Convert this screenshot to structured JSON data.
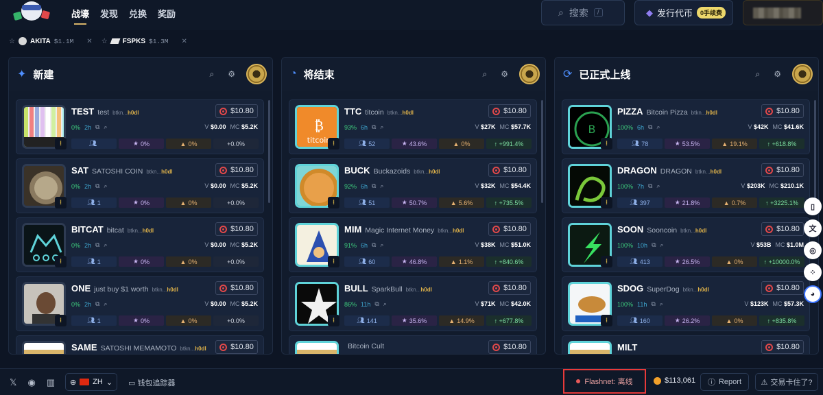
{
  "nav": {
    "items": [
      "战壕",
      "发现",
      "兑换",
      "奖励"
    ],
    "active": 0
  },
  "header": {
    "search_label": "搜索",
    "search_shortcut": "/",
    "issue_label": "发行代币",
    "issue_fee_badge": "0手续费"
  },
  "watchlist": [
    {
      "symbol": "AKITA",
      "value": "$1.1M"
    },
    {
      "symbol": "FSPKS",
      "value": "$1.3M"
    }
  ],
  "panels": [
    {
      "title": "新建",
      "cards": [
        {
          "symbol": "TEST",
          "name": "test",
          "creator_prefix": "btkn...",
          "creator_suffix": "h0dl",
          "price": "$10.80",
          "pct": "0%",
          "age": "2h",
          "vol": "$0.00",
          "mc": "$5.2K",
          "holders": "",
          "stars": "0%",
          "fire": "0%",
          "change": "0.0%",
          "change_label": "+0.0%",
          "thumb": "grid",
          "cyan": false
        },
        {
          "symbol": "SAT",
          "name": "SATOSHI COIN",
          "creator_prefix": "btkn...",
          "creator_suffix": "h0dl",
          "price": "$10.80",
          "pct": "0%",
          "age": "2h",
          "vol": "$0.00",
          "mc": "$5.2K",
          "holders": "1",
          "stars": "0%",
          "fire": "0%",
          "change_label": "+0.0%",
          "thumb": "coin",
          "cyan": false
        },
        {
          "symbol": "BITCAT",
          "name": "bitcat",
          "creator_prefix": "btkn...",
          "creator_suffix": "h0dl",
          "price": "$10.80",
          "pct": "0%",
          "age": "2h",
          "vol": "$0.00",
          "mc": "$5.2K",
          "holders": "1",
          "stars": "0%",
          "fire": "0%",
          "change_label": "+0.0%",
          "thumb": "cat",
          "cyan": false
        },
        {
          "symbol": "ONE",
          "name": "just buy $1 worth",
          "creator_prefix": "btkn...",
          "creator_suffix": "h0dl",
          "price": "$10.80",
          "pct": "0%",
          "age": "2h",
          "vol": "$0.00",
          "mc": "$5.2K",
          "holders": "1",
          "stars": "0%",
          "fire": "0%",
          "change_label": "+0.0%",
          "thumb": "face",
          "cyan": false
        },
        {
          "symbol": "SAME",
          "name": "SATOSHI MEMAMOTO",
          "creator_prefix": "btkn...",
          "creator_suffix": "h0dl",
          "price": "$10.80",
          "pct": "",
          "age": "",
          "vol": "",
          "mc": "",
          "holders": "",
          "stars": "",
          "fire": "",
          "change_label": "",
          "thumb": "gold",
          "cyan": false
        }
      ]
    },
    {
      "title": "将结束",
      "cards": [
        {
          "symbol": "TTC",
          "name": "titcoin",
          "creator_prefix": "btkn...",
          "creator_suffix": "h0dl",
          "price": "$10.80",
          "pct": "93%",
          "age": "6h",
          "vol": "$27K",
          "mc": "$57.7K",
          "holders": "52",
          "stars": "43.6%",
          "fire": "0%",
          "change_label": "↑ +991.4%",
          "thumb": "titcoin",
          "cyan": true
        },
        {
          "symbol": "BUCK",
          "name": "Buckazoids",
          "creator_prefix": "btkn...",
          "creator_suffix": "h0dl",
          "price": "$10.80",
          "pct": "92%",
          "age": "6h",
          "vol": "$32K",
          "mc": "$54.4K",
          "holders": "51",
          "stars": "50.7%",
          "fire": "5.6%",
          "change_label": "↑ +735.5%",
          "thumb": "buck",
          "cyan": true
        },
        {
          "symbol": "MIM",
          "name": "Magic Internet Money",
          "creator_prefix": "btkn...",
          "creator_suffix": "h0dl",
          "price": "$10.80",
          "pct": "91%",
          "age": "6h",
          "vol": "$38K",
          "mc": "$51.0K",
          "holders": "60",
          "stars": "46.8%",
          "fire": "1.1%",
          "change_label": "↑ +840.6%",
          "thumb": "wizard",
          "cyan": true
        },
        {
          "symbol": "BULL",
          "name": "SparkBull",
          "creator_prefix": "btkn...",
          "creator_suffix": "h0dl",
          "price": "$10.80",
          "pct": "86%",
          "age": "11h",
          "vol": "$71K",
          "mc": "$42.0K",
          "holders": "141",
          "stars": "35.6%",
          "fire": "14.9%",
          "change_label": "↑ +677.8%",
          "thumb": "star",
          "cyan": true
        },
        {
          "symbol": "",
          "name": "Bitcoin Cult",
          "creator_prefix": "",
          "creator_suffix": "",
          "price": "$10.80",
          "pct": "",
          "age": "",
          "vol": "",
          "mc": "",
          "holders": "",
          "stars": "",
          "fire": "",
          "change_label": "",
          "thumb": "gold",
          "cyan": true
        }
      ]
    },
    {
      "title": "已正式上线",
      "cards": [
        {
          "symbol": "PIZZA",
          "name": "Bitcoin Pizza",
          "creator_prefix": "btkn...",
          "creator_suffix": "h0dl",
          "price": "$10.80",
          "pct": "100%",
          "age": "6h",
          "vol": "$42K",
          "mc": "$41.6K",
          "holders": "78",
          "stars": "53.5%",
          "fire": "19.1%",
          "change_label": "↑ +618.8%",
          "thumb": "pizza",
          "cyan": true
        },
        {
          "symbol": "DRAGON",
          "name": "DRAGON",
          "creator_prefix": "btkn...",
          "creator_suffix": "h0dl",
          "price": "$10.80",
          "pct": "100%",
          "age": "7h",
          "vol": "$203K",
          "mc": "$210.1K",
          "holders": "397",
          "stars": "21.8%",
          "fire": "0.7%",
          "change_label": "↑ +3225.1%",
          "thumb": "dragon",
          "cyan": true
        },
        {
          "symbol": "SOON",
          "name": "Sooncoin",
          "creator_prefix": "btkn...",
          "creator_suffix": "h0dl",
          "price": "$10.80",
          "pct": "100%",
          "age": "10h",
          "vol": "$53B",
          "mc": "$1.0M",
          "holders": "413",
          "stars": "26.5%",
          "fire": "0%",
          "change_label": "↑ +10000.0%",
          "thumb": "soon",
          "cyan": true
        },
        {
          "symbol": "SDOG",
          "name": "SuperDog",
          "creator_prefix": "btkn...",
          "creator_suffix": "h0dl",
          "price": "$10.80",
          "pct": "100%",
          "age": "11h",
          "vol": "$123K",
          "mc": "$57.3K",
          "holders": "160",
          "stars": "26.2%",
          "fire": "0%",
          "change_label": "↑ +835.8%",
          "thumb": "dog",
          "cyan": true
        },
        {
          "symbol": "MILT",
          "name": "",
          "creator_prefix": "",
          "creator_suffix": "",
          "price": "$10.80",
          "pct": "",
          "age": "",
          "vol": "",
          "mc": "",
          "holders": "",
          "stars": "",
          "fire": "",
          "change_label": "",
          "thumb": "gold",
          "cyan": true
        }
      ]
    }
  ],
  "footer": {
    "lang": "ZH",
    "wallet_tracker": "钱包追踪器",
    "flashnet_label": "Flashnet: 离线",
    "btc_price": "$113,061",
    "report": "Report",
    "stuck": "交易卡住了?"
  },
  "colors": {
    "accent_gold": "#d9b56a",
    "positive": "#3fd07f",
    "alert_red": "#e83a3a",
    "cyan_border": "#5fd3d9"
  }
}
